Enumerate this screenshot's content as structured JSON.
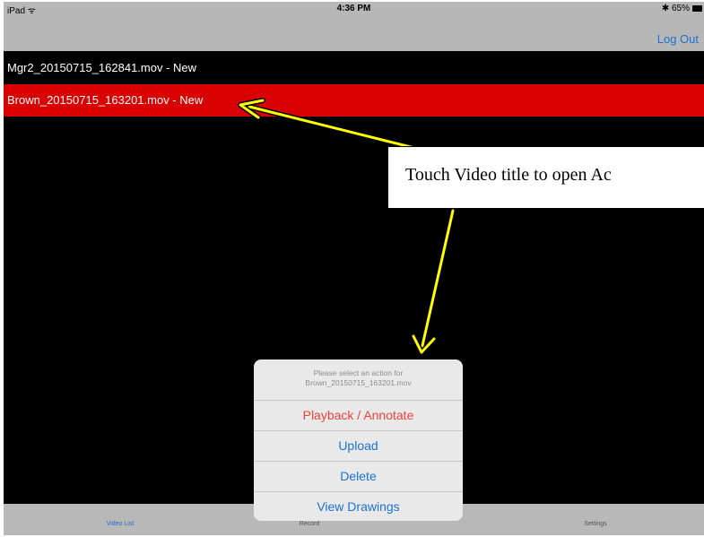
{
  "status_bar": {
    "device": "iPad ᯤ",
    "time": "4:36 PM",
    "battery": "✱ 65%"
  },
  "nav": {
    "logout_label": "Log Out"
  },
  "videos": [
    {
      "label": "Mgr2_20150715_162841.mov - New"
    },
    {
      "label": "Brown_20150715_163201.mov - New",
      "selected": true
    }
  ],
  "action_sheet": {
    "title_line1": "Please select an action for",
    "title_line2": "Brown_20150715_163201.mov",
    "actions": [
      "Playback / Annotate",
      "Upload",
      "Delete",
      "View Drawings"
    ]
  },
  "tabs": [
    "Video List",
    "Record",
    "Settings"
  ],
  "annotation": {
    "text": "Touch Video title to open Ac"
  },
  "colors": {
    "selected_row": "#d80000",
    "accent": "#1a73d6",
    "destructive": "#f0423a",
    "arrow": "#ffff00"
  }
}
